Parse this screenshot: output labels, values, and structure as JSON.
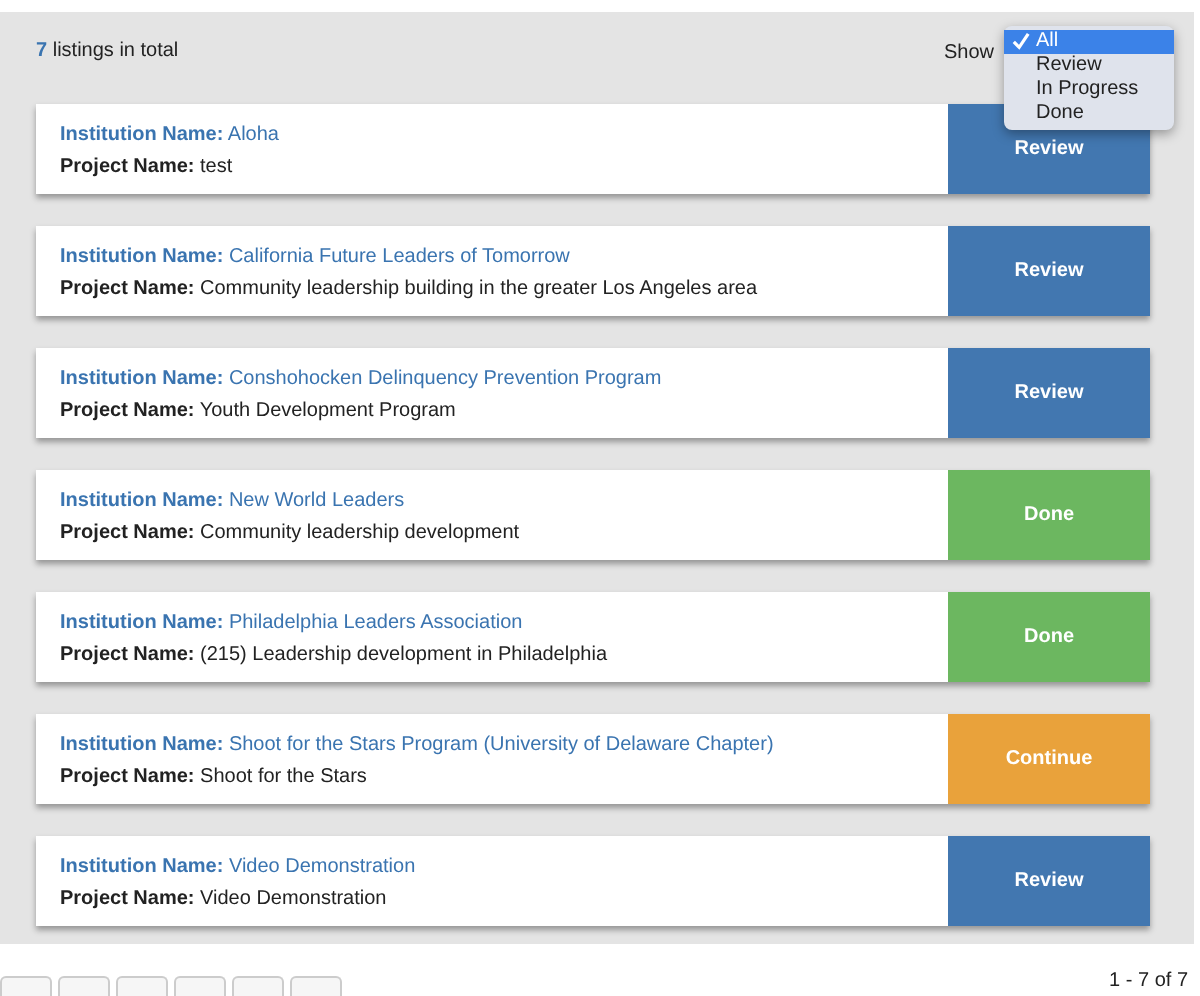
{
  "summary": {
    "count": "7",
    "text": "listings in total"
  },
  "filter": {
    "label": "Show",
    "options": [
      {
        "label": "All",
        "selected": true
      },
      {
        "label": "Review",
        "selected": false
      },
      {
        "label": "In Progress",
        "selected": false
      },
      {
        "label": "Done",
        "selected": false
      }
    ]
  },
  "listings": [
    {
      "institution_label": "Institution Name:",
      "institution": "Aloha",
      "project_label": "Project Name:",
      "project": "test",
      "action": {
        "label": "Review",
        "kind": "review"
      }
    },
    {
      "institution_label": "Institution Name:",
      "institution": "California Future Leaders of Tomorrow",
      "project_label": "Project Name:",
      "project": "Community leadership building in the greater Los Angeles area",
      "action": {
        "label": "Review",
        "kind": "review"
      }
    },
    {
      "institution_label": "Institution Name:",
      "institution": "Conshohocken Delinquency Prevention Program",
      "project_label": "Project Name:",
      "project": "Youth Development Program",
      "action": {
        "label": "Review",
        "kind": "review"
      }
    },
    {
      "institution_label": "Institution Name:",
      "institution": "New World Leaders",
      "project_label": "Project Name:",
      "project": "Community leadership development",
      "action": {
        "label": "Done",
        "kind": "done"
      }
    },
    {
      "institution_label": "Institution Name:",
      "institution": "Philadelphia Leaders Association",
      "project_label": "Project Name:",
      "project": "(215) Leadership development in Philadelphia",
      "action": {
        "label": "Done",
        "kind": "done"
      }
    },
    {
      "institution_label": "Institution Name:",
      "institution": "Shoot for the Stars Program (University of Delaware Chapter)",
      "project_label": "Project Name:",
      "project": "Shoot for the Stars",
      "action": {
        "label": "Continue",
        "kind": "continue"
      }
    },
    {
      "institution_label": "Institution Name:",
      "institution": "Video Demonstration",
      "project_label": "Project Name:",
      "project": "Video Demonstration",
      "action": {
        "label": "Review",
        "kind": "review"
      }
    }
  ],
  "pager": {
    "range": "1 - 7 of 7"
  }
}
